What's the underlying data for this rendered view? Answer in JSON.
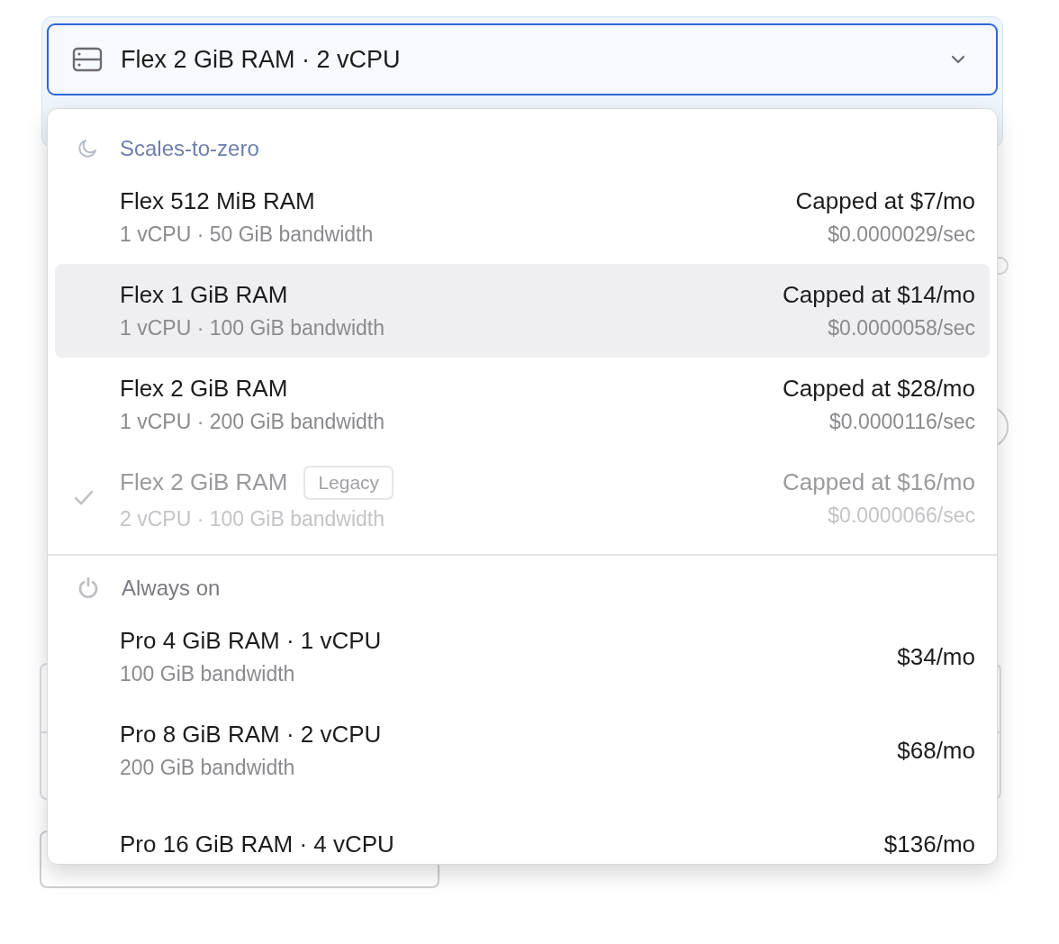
{
  "trigger": {
    "label": "Flex 2 GiB RAM · 2 vCPU",
    "expanded": true
  },
  "groups": [
    {
      "title": "Scales-to-zero",
      "kind": "moon",
      "color": "#6e7fae",
      "options": [
        {
          "title": "Flex 512 MiB RAM",
          "subtitle": "1 vCPU · 50 GiB bandwidth",
          "price": "Capped at $7/mo",
          "rate": "$0.0000029/sec",
          "selected": false,
          "hovered": false,
          "disabled": false
        },
        {
          "title": "Flex 1 GiB RAM",
          "subtitle": "1 vCPU · 100 GiB bandwidth",
          "price": "Capped at $14/mo",
          "rate": "$0.0000058/sec",
          "selected": false,
          "hovered": true,
          "disabled": false
        },
        {
          "title": "Flex 2 GiB RAM",
          "subtitle": "1 vCPU · 200 GiB bandwidth",
          "price": "Capped at $28/mo",
          "rate": "$0.0000116/sec",
          "selected": false,
          "hovered": false,
          "disabled": false
        },
        {
          "title": "Flex 2 GiB RAM",
          "badge": "Legacy",
          "subtitle": "2 vCPU · 100 GiB bandwidth",
          "price": "Capped at $16/mo",
          "rate": "$0.0000066/sec",
          "selected": true,
          "hovered": false,
          "disabled": true
        }
      ]
    },
    {
      "title": "Always on",
      "kind": "power",
      "color": "#7a7a80",
      "options": [
        {
          "title": "Pro 4 GiB RAM · 1 vCPU",
          "subtitle": "100 GiB bandwidth",
          "price": "$34/mo",
          "selected": false,
          "hovered": false,
          "disabled": false
        },
        {
          "title": "Pro 8 GiB RAM · 2 vCPU",
          "subtitle": "200 GiB bandwidth",
          "price": "$68/mo",
          "selected": false,
          "hovered": false,
          "disabled": false
        },
        {
          "title": "Pro 16 GiB RAM · 4 vCPU",
          "price": "$136/mo",
          "selected": false,
          "hovered": false,
          "disabled": false
        }
      ]
    }
  ]
}
